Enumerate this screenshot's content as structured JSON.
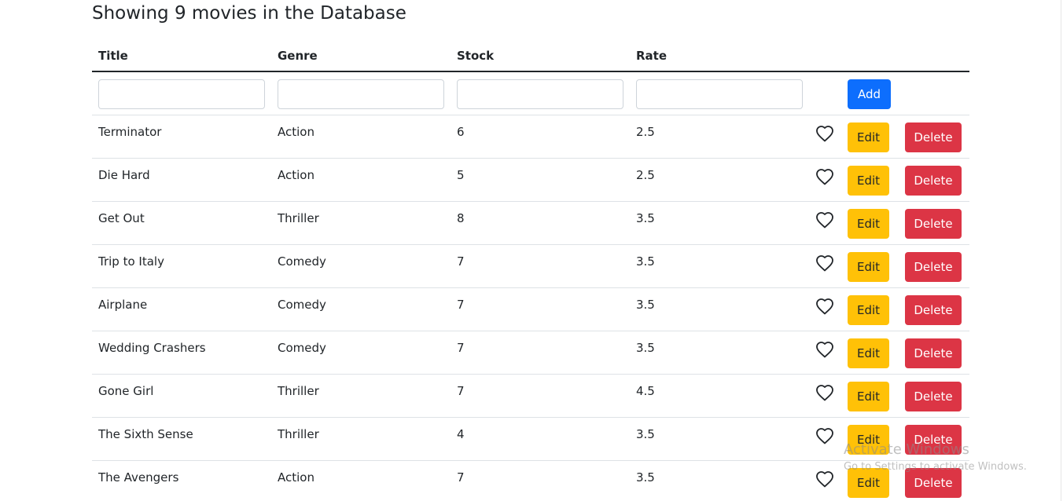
{
  "heading": "Showing 9 movies in the Database",
  "columns": {
    "title": "Title",
    "genre": "Genre",
    "stock": "Stock",
    "rate": "Rate"
  },
  "new_movie": {
    "title": "",
    "genre": "",
    "stock": "",
    "rate": "",
    "add_label": "Add"
  },
  "action_labels": {
    "edit": "Edit",
    "delete": "Delete",
    "like_icon": "heart-outline-icon"
  },
  "movies": [
    {
      "title": "Terminator",
      "genre": "Action",
      "stock": "6",
      "rate": "2.5"
    },
    {
      "title": "Die Hard",
      "genre": "Action",
      "stock": "5",
      "rate": "2.5"
    },
    {
      "title": "Get Out",
      "genre": "Thriller",
      "stock": "8",
      "rate": "3.5"
    },
    {
      "title": "Trip to Italy",
      "genre": "Comedy",
      "stock": "7",
      "rate": "3.5"
    },
    {
      "title": "Airplane",
      "genre": "Comedy",
      "stock": "7",
      "rate": "3.5"
    },
    {
      "title": "Wedding Crashers",
      "genre": "Comedy",
      "stock": "7",
      "rate": "3.5"
    },
    {
      "title": "Gone Girl",
      "genre": "Thriller",
      "stock": "7",
      "rate": "4.5"
    },
    {
      "title": "The Sixth Sense",
      "genre": "Thriller",
      "stock": "4",
      "rate": "3.5"
    },
    {
      "title": "The Avengers",
      "genre": "Action",
      "stock": "7",
      "rate": "3.5"
    }
  ],
  "watermark": {
    "title": "Activate Windows",
    "subtitle": "Go to Settings to activate Windows."
  },
  "colors": {
    "primary": "#0d6efd",
    "warning": "#ffc107",
    "danger": "#dc3545"
  }
}
